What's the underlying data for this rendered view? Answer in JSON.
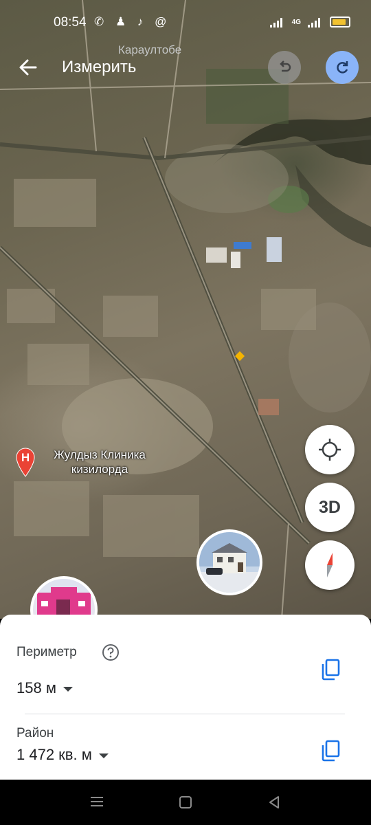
{
  "status_bar": {
    "time": "08:54",
    "notification_icons": "✆ ♟ ♪ @",
    "network": "4G"
  },
  "map": {
    "place_label_top": "Караултобе",
    "poi": {
      "name_line1": "Жулдыз Клиника",
      "name_line2": "кизилорда",
      "pin_letter": "H",
      "pin_color": "#ea4335"
    },
    "imagery": "satellite"
  },
  "header": {
    "title": "Измерить",
    "back_icon": "arrow-left-icon",
    "undo_icon": "undo-icon",
    "redo_icon": "redo-icon",
    "redo_color": "#8ab4f8"
  },
  "controls": {
    "locate_icon": "crosshair-icon",
    "three_d_label": "3D",
    "compass_icon": "compass-icon"
  },
  "measurement": {
    "perimeter_label": "Периметр",
    "perimeter_value": "158 м",
    "area_label": "Район",
    "area_value": "1 472 кв. м",
    "help_icon": "question-icon",
    "copy_icon": "copy-icon",
    "accent": "#1a73e8"
  },
  "nav": {
    "items": [
      "menu-icon",
      "home-icon",
      "back-icon"
    ]
  }
}
